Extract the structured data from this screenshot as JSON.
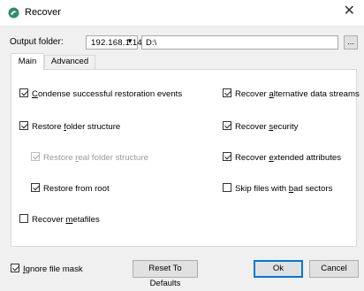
{
  "window": {
    "title": "Recover",
    "close_glyph": "✕",
    "icon": "recover-app-icon"
  },
  "output": {
    "label_pre": "Output folder",
    "label_post": ":",
    "host": "192.168.1.14",
    "host_arrow": "▼",
    "path": "D:\\",
    "browse_label": "..."
  },
  "tabs": [
    {
      "label": "Main",
      "selected": true
    },
    {
      "label": "Advanced",
      "selected": false
    }
  ],
  "options": {
    "condense": {
      "a": "",
      "k": "C",
      "b": "ondense successful restoration events",
      "checked": true,
      "enabled": true
    },
    "restore_folder": {
      "a": "Restore ",
      "k": "f",
      "b": "older structure",
      "checked": true,
      "enabled": true
    },
    "restore_real": {
      "a": "Restore ",
      "k": "r",
      "b": "eal folder structure",
      "checked": true,
      "enabled": false
    },
    "restore_root": {
      "text": "Restore from root",
      "checked": true,
      "enabled": true
    },
    "recover_meta": {
      "a": "Recover ",
      "k": "m",
      "b": "etafiles",
      "checked": false,
      "enabled": true
    },
    "recover_alt": {
      "a": "Recover ",
      "k": "a",
      "b": "lternative data streams",
      "checked": true,
      "enabled": true
    },
    "recover_sec": {
      "a": "Recover ",
      "k": "s",
      "b": "ecurity",
      "checked": true,
      "enabled": true
    },
    "recover_ext": {
      "a": "Recover ",
      "k": "e",
      "b": "xtended attributes",
      "checked": true,
      "enabled": true
    },
    "skip_bad": {
      "a": "Skip files with ",
      "k": "b",
      "b": "ad sectors",
      "checked": false,
      "enabled": true
    }
  },
  "footer": {
    "ignore": {
      "a": "",
      "k": "I",
      "b": "gnore file mask",
      "checked": true
    },
    "reset_label": "Reset To Defaults",
    "ok_label": "Ok",
    "cancel_label": "Cancel"
  },
  "colors": {
    "accent": "#0078d7",
    "disabled_text": "#9a9a9a"
  }
}
